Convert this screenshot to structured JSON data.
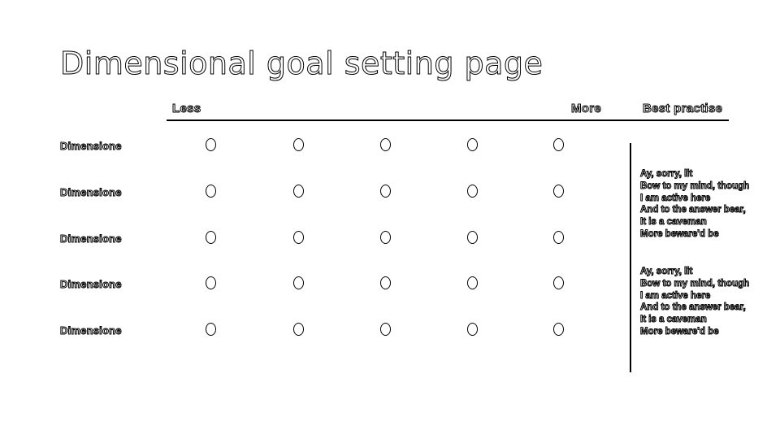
{
  "title": "Dimensional goal setting page",
  "scale": {
    "less_label": "Less",
    "more_label": "More",
    "practice_label": "Best practise",
    "option_count": 5
  },
  "rows": [
    {
      "label": "Dimensione"
    },
    {
      "label": "Dimensione"
    },
    {
      "label": "Dimensione"
    },
    {
      "label": "Dimensione"
    },
    {
      "label": "Dimensione"
    }
  ],
  "best_practice": [
    {
      "lines": [
        "Ay, sorry, lit",
        "Bow to my mind, though",
        "I am active here",
        "And to the answer bear,",
        "It is a caveman",
        "More beware'd be"
      ]
    },
    {
      "lines": [
        "Ay, sorry, lit",
        "Bow to my mind, though",
        "I am active here",
        "And to the answer bear,",
        "It is a caveman",
        "More beware'd be"
      ]
    }
  ]
}
